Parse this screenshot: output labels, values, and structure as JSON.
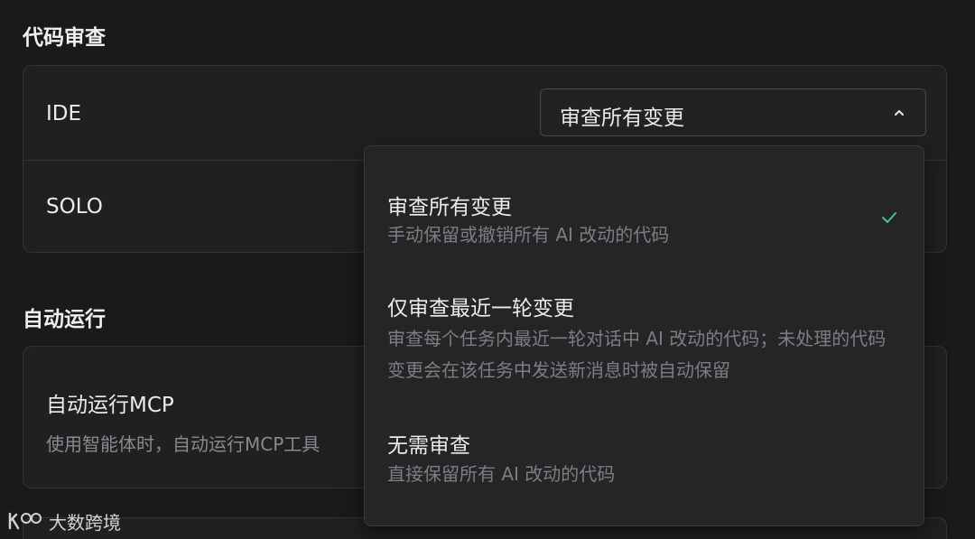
{
  "code_review": {
    "title": "代码审查",
    "rows": [
      {
        "label": "IDE",
        "selected": "审查所有变更"
      },
      {
        "label": "SOLO"
      }
    ]
  },
  "auto_run": {
    "title": "自动运行",
    "mcp": {
      "label": "自动运行MCP",
      "description": "使用智能体时，自动运行MCP工具"
    }
  },
  "dropdown": {
    "options": [
      {
        "title": "审查所有变更",
        "desc": "手动保留或撤销所有 AI 改动的代码",
        "selected": true
      },
      {
        "title": "仅审查最近一轮变更",
        "desc": "审查每个任务内最近一轮对话中 AI 改动的代码；未处理的代码变更会在该任务中发送新消息时被自动保留",
        "selected": false
      },
      {
        "title": "无需审查",
        "desc": "直接保留所有 AI 改动的代码",
        "selected": false
      }
    ]
  },
  "watermark": {
    "text": "大数跨境"
  },
  "colors": {
    "background": "#1a1a1c",
    "card": "#202022",
    "check": "#4ec28a"
  }
}
